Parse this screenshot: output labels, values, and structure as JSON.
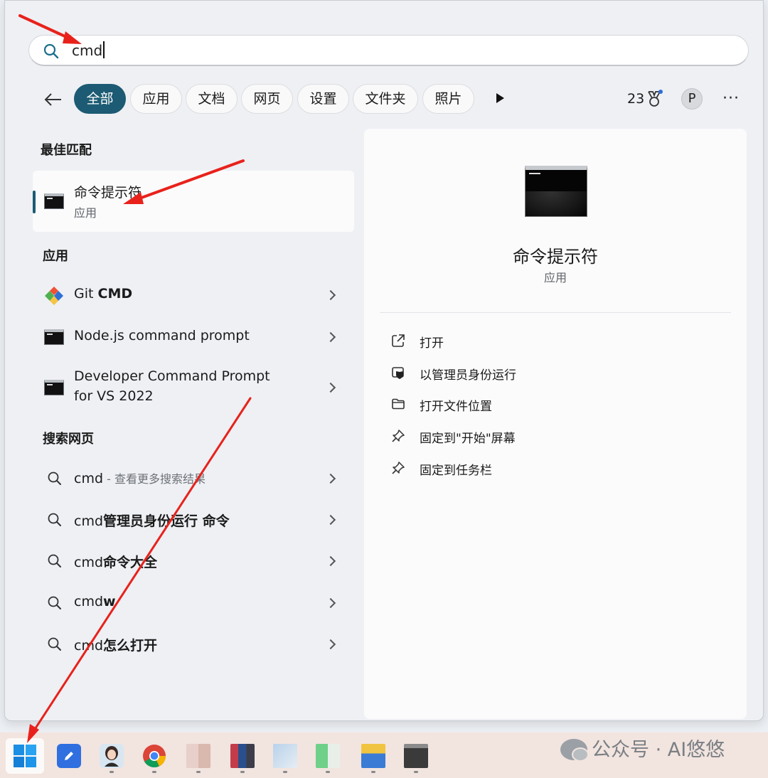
{
  "search": {
    "value": "cmd"
  },
  "filters": {
    "chips": [
      "全部",
      "应用",
      "文档",
      "网页",
      "设置",
      "文件夹",
      "照片"
    ],
    "active": "全部"
  },
  "header_right": {
    "points": "23",
    "avatar_letter": "P"
  },
  "best_match": {
    "heading": "最佳匹配",
    "name": "命令提示符",
    "type": "应用"
  },
  "apps": {
    "heading": "应用",
    "items": [
      {
        "prefix": "Git ",
        "bold": "CMD",
        "icon": "git-icon"
      },
      {
        "label": "Node.js command prompt",
        "icon": "terminal-icon"
      },
      {
        "label_line1": "Developer Command Prompt",
        "label_line2": "for VS 2022",
        "icon": "terminal-icon"
      }
    ]
  },
  "web": {
    "heading": "搜索网页",
    "items": [
      {
        "prefix": "cmd",
        "suffix": " - 查看更多搜索结果"
      },
      {
        "prefix": "cmd",
        "bold": "管理员身份运行 命令"
      },
      {
        "prefix": "cmd",
        "bold": "命令大全"
      },
      {
        "prefix": "cmd",
        "bold": "w"
      },
      {
        "prefix": "cmd",
        "bold": "怎么打开"
      }
    ]
  },
  "preview": {
    "title": "命令提示符",
    "type": "应用",
    "actions": [
      {
        "label": "打开",
        "icon": "open-external-icon"
      },
      {
        "label": "以管理员身份运行",
        "icon": "shield-run-icon"
      },
      {
        "label": "打开文件位置",
        "icon": "folder-icon"
      },
      {
        "label": "固定到\"开始\"屏幕",
        "icon": "pin-icon"
      },
      {
        "label": "固定到任务栏",
        "icon": "pin-icon"
      }
    ]
  },
  "watermark": {
    "text": "公众号 · AI悠悠"
  },
  "colors": {
    "accent": "#1c5b73",
    "annotation_arrow": "#e8221b"
  }
}
